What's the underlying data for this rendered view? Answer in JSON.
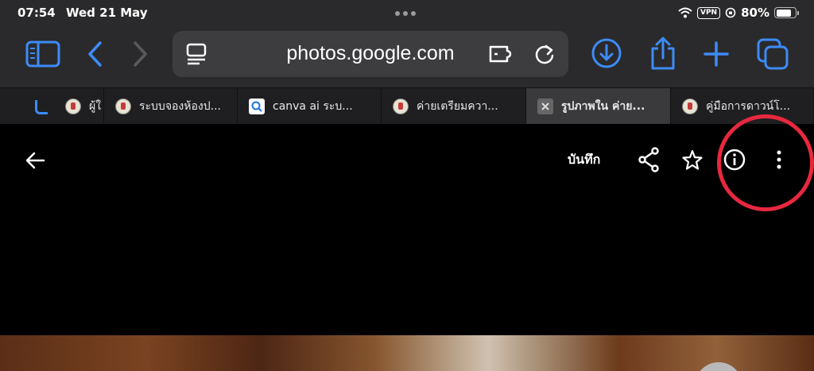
{
  "status_bar": {
    "time": "07:54",
    "date": "Wed 21 May",
    "vpn": "VPN",
    "battery": "80%",
    "battery_level": 0.8
  },
  "toolbar": {
    "url": "photos.google.com",
    "icons": [
      "sidebar-icon",
      "back-icon",
      "forward-icon",
      "reader-icon",
      "extension-icon",
      "reload-icon",
      "download-icon",
      "share-icon",
      "new-tab-icon",
      "tabs-overview-icon"
    ],
    "accent_color": "#3d8bf5"
  },
  "tabs": [
    {
      "title": "ผู้ใ",
      "favicon": "school-logo-icon"
    },
    {
      "title": "ระบบจองห้องป...",
      "favicon": "school-logo-icon"
    },
    {
      "title": "canva ai ระบ...",
      "favicon": "search-icon"
    },
    {
      "title": "ค่ายเตรียมควา...",
      "favicon": "school-logo-icon"
    },
    {
      "title": "รูปภาพใน ค่าย...",
      "favicon": "close-icon",
      "active": true
    },
    {
      "title": "คู่มือการดาวน์โ...",
      "favicon": "school-logo-icon"
    }
  ],
  "viewer": {
    "save_label": "บันทึก",
    "actions": [
      "back-arrow-icon",
      "share-icon",
      "star-icon",
      "info-icon",
      "more-options-icon"
    ],
    "highlight_color": "#e8283e"
  }
}
